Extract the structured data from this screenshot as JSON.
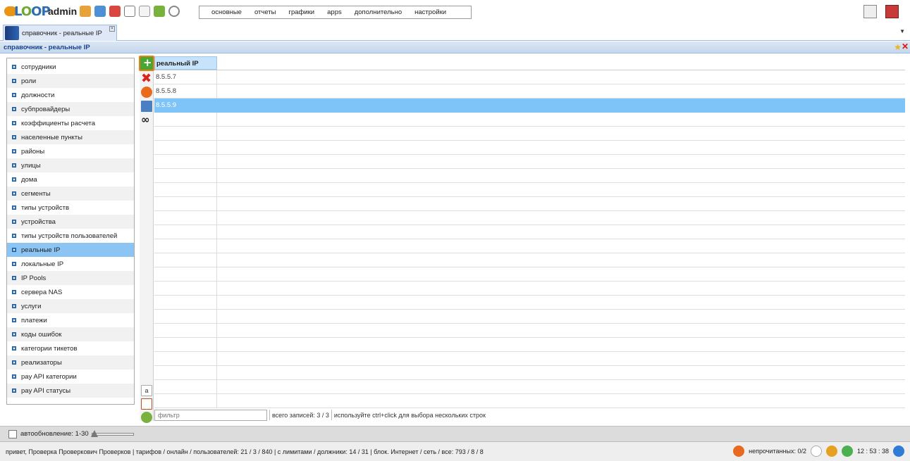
{
  "user": {
    "name": "admin"
  },
  "menu": [
    "основные",
    "отчеты",
    "графики",
    "apps",
    "дополнительно",
    "настройки"
  ],
  "tab": {
    "label": "справочник - реальные IP"
  },
  "panel": {
    "title": "справочник - реальные IP"
  },
  "sidebar": {
    "items": [
      "сотрудники",
      "роли",
      "должности",
      "субпровайдеры",
      "коэффициенты расчета",
      "населенные пункты",
      "районы",
      "улицы",
      "дома",
      "сегменты",
      "типы устройств",
      "устройства",
      "типы устройств пользователей",
      "реальные IP",
      "локальные IP",
      "IP Pools",
      "сервера NAS",
      "услуги",
      "платежи",
      "коды ошибок",
      "категории тикетов",
      "реализаторы",
      "pay API категории",
      "pay API статусы"
    ],
    "active_index": 13
  },
  "grid": {
    "column": "реальный IP",
    "rows": [
      "8.5.5.7",
      "8.5.5.8",
      "8.5.5.9"
    ],
    "selected_index": 2
  },
  "footer": {
    "filter_placeholder": "фильтр",
    "records": "всего записей: 3 / 3",
    "hint": "используйте ctrl+click для выбора нескольких строк"
  },
  "autoupdate": {
    "label": "автообновление: 1-30"
  },
  "status": {
    "text": "привет, Проверка Проверкович Проверков | тарифов / онлайн / пользователей: 21 / 3 / 840 | с лимитами / должники: 14 / 31 | блок. Интернет / сеть / все: 793 / 8 / 8",
    "unread": "непрочитанных: 0/2",
    "clock": "12 : 53 : 38"
  }
}
